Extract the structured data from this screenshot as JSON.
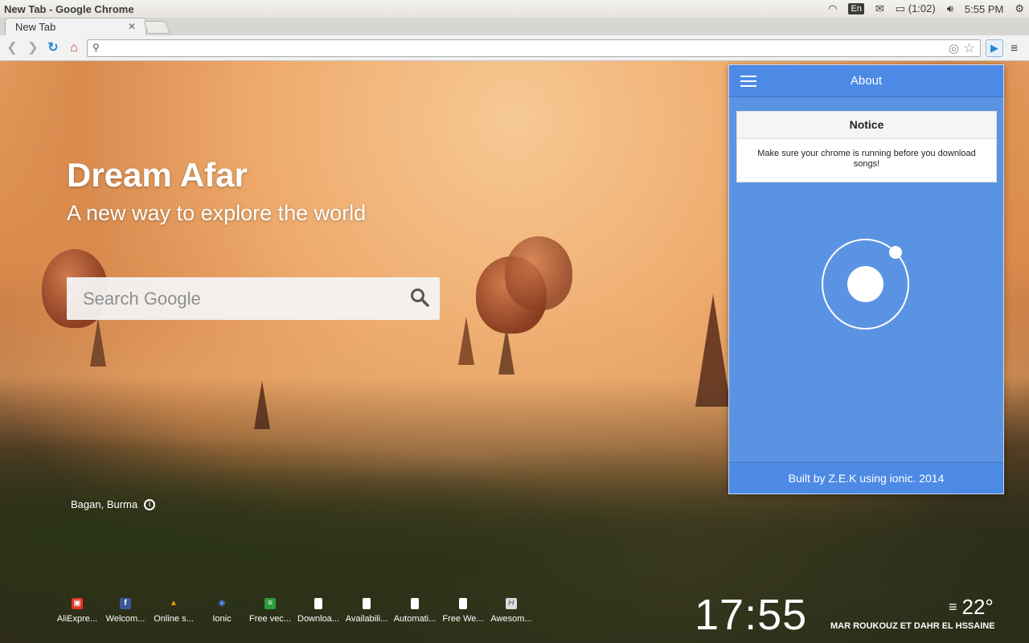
{
  "window": {
    "title": "New Tab - Google Chrome"
  },
  "tray": {
    "keyboard": "En",
    "battery": "(1:02)",
    "time": "5:55 PM"
  },
  "tabs": [
    {
      "label": "New Tab"
    }
  ],
  "omnibox": {
    "value": ""
  },
  "hero": {
    "title": "Dream Afar",
    "subtitle": "A new way to explore the world"
  },
  "search": {
    "placeholder": "Search Google"
  },
  "location": {
    "name": "Bagan, Burma"
  },
  "bookmarks": [
    {
      "label": "AliExpre...",
      "icon": "aliexpress-icon",
      "color": "#e43225"
    },
    {
      "label": "Welcom...",
      "icon": "facebook-icon",
      "color": "#3b5998"
    },
    {
      "label": "Online s...",
      "icon": "amazon-icon",
      "color": "#ff9900"
    },
    {
      "label": "Ionic",
      "icon": "ionic-icon",
      "color": "#4e8ef7"
    },
    {
      "label": "Free vec...",
      "icon": "freepik-icon",
      "color": "#2a9d3b"
    },
    {
      "label": "Downloa...",
      "icon": "page-icon",
      "color": "#ffffff"
    },
    {
      "label": "Availabili...",
      "icon": "page-icon",
      "color": "#ffffff"
    },
    {
      "label": "Automati...",
      "icon": "page-icon",
      "color": "#ffffff"
    },
    {
      "label": "Free We...",
      "icon": "page-icon",
      "color": "#ffffff"
    },
    {
      "label": "Awesom...",
      "icon": "script-icon",
      "color": "#dddddd"
    }
  ],
  "clock": {
    "time": "17:55"
  },
  "weather": {
    "temp": "22°",
    "place": "MAR ROUKOUZ ET DAHR EL HSSAINE"
  },
  "popup": {
    "title": "About",
    "notice_title": "Notice",
    "notice_body": "Make sure your chrome is running before you download songs!",
    "footer": "Built by Z.E.K using ionic. 2014",
    "accent": "#4d8ae6"
  }
}
